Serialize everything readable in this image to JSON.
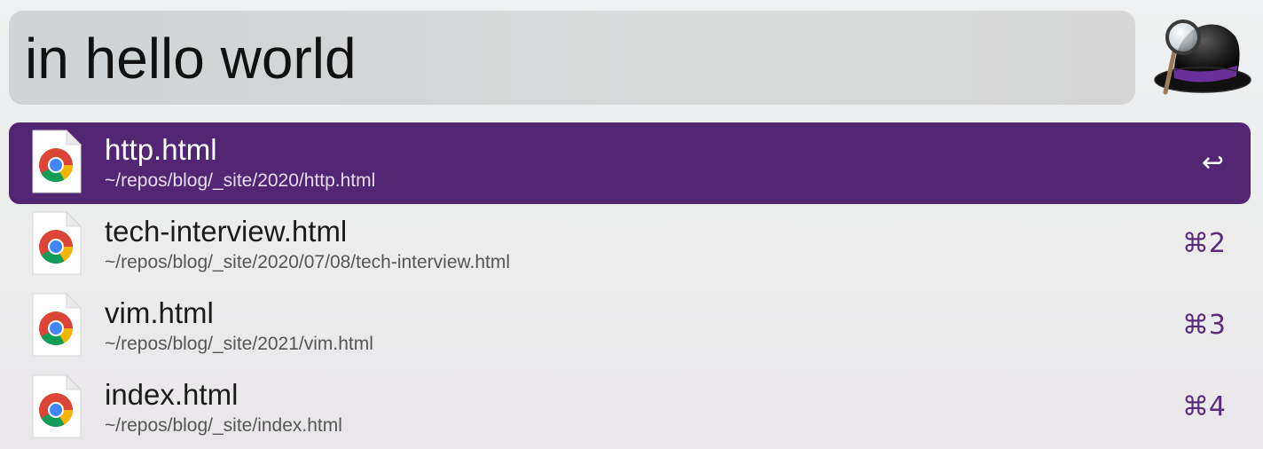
{
  "search": {
    "query": "in hello world"
  },
  "logo": {
    "icon": "alfred-hat-magnifier-icon"
  },
  "colors": {
    "selection": "#532673",
    "shortcut": "#5a2d7a"
  },
  "results": [
    {
      "title": "http.html",
      "subtitle": "~/repos/blog/_site/2020/http.html",
      "shortcut": "↩",
      "icon": "chrome-html-file-icon",
      "selected": true
    },
    {
      "title": "tech-interview.html",
      "subtitle": "~/repos/blog/_site/2020/07/08/tech-interview.html",
      "shortcut": "⌘2",
      "icon": "chrome-html-file-icon",
      "selected": false
    },
    {
      "title": "vim.html",
      "subtitle": "~/repos/blog/_site/2021/vim.html",
      "shortcut": "⌘3",
      "icon": "chrome-html-file-icon",
      "selected": false
    },
    {
      "title": "index.html",
      "subtitle": "~/repos/blog/_site/index.html",
      "shortcut": "⌘4",
      "icon": "chrome-html-file-icon",
      "selected": false
    }
  ]
}
